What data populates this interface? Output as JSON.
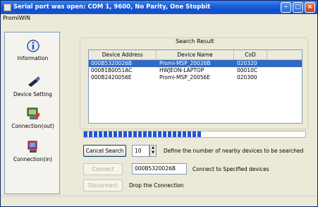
{
  "window": {
    "title": "Serial port was open: COM 1, 9600, No Parity, One Stopbit",
    "app_name": "PromiWIN"
  },
  "sidebar": {
    "items": [
      {
        "label": "Information",
        "icon": "info-icon"
      },
      {
        "label": "Device Setting",
        "icon": "device-setting-icon"
      },
      {
        "label": "Connection(out)",
        "icon": "connection-out-icon"
      },
      {
        "label": "Connection(in)",
        "icon": "connection-in-icon"
      }
    ]
  },
  "search_result": {
    "title": "Search Result",
    "columns": [
      "Device Address",
      "Device Name",
      "CoD",
      ""
    ],
    "rows": [
      {
        "address": "000B5320026B",
        "name": "Promi-MSP_20026B",
        "cod": "020320",
        "selected": true
      },
      {
        "address": "00081B0051AC",
        "name": "HWJEON-LAPTOP",
        "cod": "00010C",
        "selected": false
      },
      {
        "address": "000B2420056E",
        "name": "Promi-MSP_20056E",
        "cod": "020300",
        "selected": false
      }
    ]
  },
  "progress": {
    "value_percent": 53
  },
  "controls": {
    "cancel_search_label": "Cancel Search",
    "nearby_count": "10",
    "nearby_description": "Define the number of nearby devices to be searched",
    "connect_label": "Connect",
    "address_value": "000B5320026B",
    "connect_description": "Connect to Specified devices",
    "disconnect_label": "Disconnect",
    "disconnect_description": "Drop the Connection"
  },
  "colors": {
    "titlebar": "#1c5fd6",
    "selection": "#316ac5",
    "progress": "#2355d0"
  }
}
